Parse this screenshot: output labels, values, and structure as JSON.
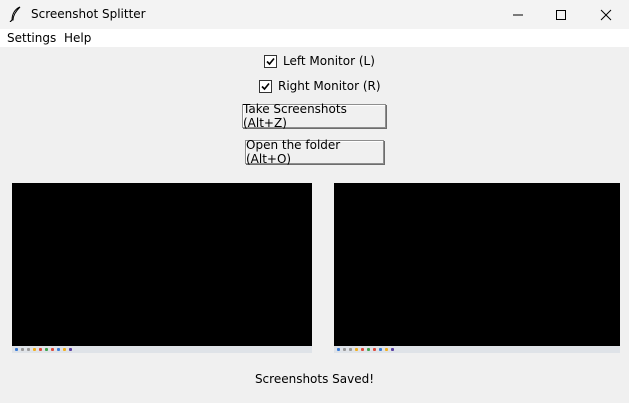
{
  "window": {
    "title": "Screenshot Splitter",
    "icon": "feather-icon",
    "controls": [
      "minimize-icon",
      "maximize-icon",
      "close-icon"
    ]
  },
  "menu": {
    "items": [
      "Settings",
      "Help"
    ]
  },
  "options": {
    "left_monitor": {
      "label": "Left Monitor (L)",
      "checked": true
    },
    "right_monitor": {
      "label": "Right Monitor (R)",
      "checked": true
    }
  },
  "buttons": {
    "take_screenshots": "Take Screenshots (Alt+Z)",
    "open_folder": "Open the folder (Alt+O)"
  },
  "status": "Screenshots Saved!"
}
